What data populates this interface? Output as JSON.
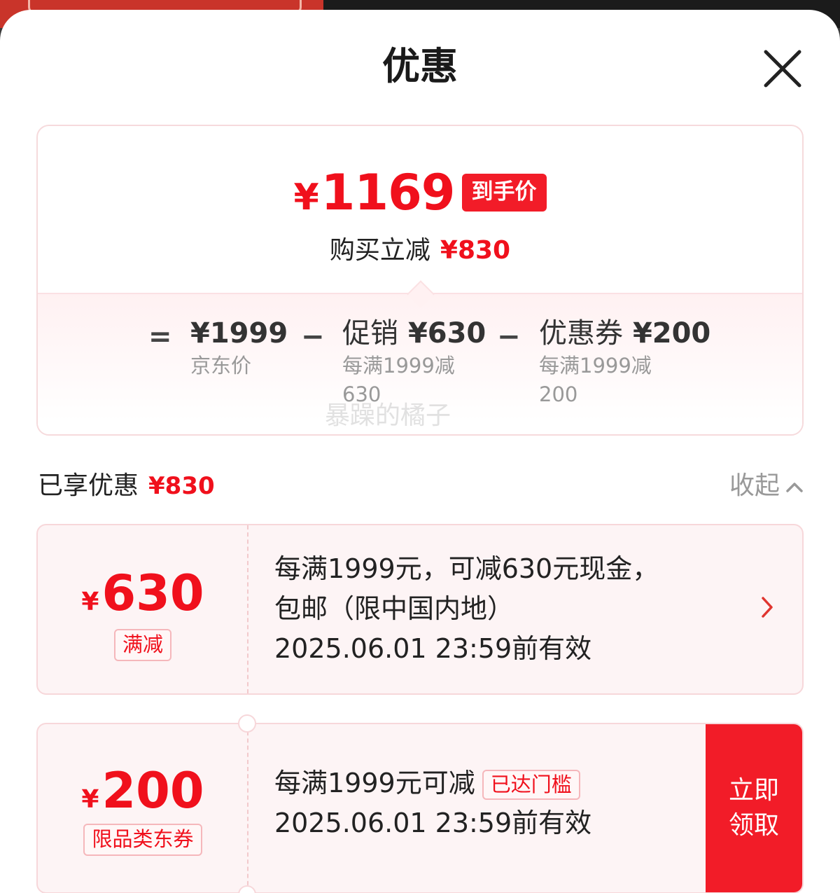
{
  "title": "优惠",
  "summary": {
    "price_yen": "¥",
    "price": "1169",
    "price_tag": "到手价",
    "reduce_label": "购买立减",
    "reduce_amount": "¥830",
    "equals": "=",
    "minus": "−",
    "items": [
      {
        "label": "",
        "value": "¥1999",
        "sub": "京东价"
      },
      {
        "label": "促销",
        "value": "¥630",
        "sub": "每满1999减630"
      },
      {
        "label": "优惠券",
        "value": "¥200",
        "sub": "每满1999减200"
      }
    ],
    "watermark": "暴躁的橘子"
  },
  "enjoyed": {
    "label": "已享优惠",
    "amount": "¥830",
    "collapse_label": "收起"
  },
  "coupons": [
    {
      "yen": "¥",
      "amount": "630",
      "tag": "满减",
      "line1": "每满1999元，可减630元现金，",
      "line2": "包邮（限中国内地）",
      "validity": "2025.06.01 23:59前有效"
    },
    {
      "yen": "¥",
      "amount": "200",
      "tag": "限品类东券",
      "line1": "每满1999元可减",
      "reach_tag": "已达门槛",
      "validity": "2025.06.01 23:59前有效",
      "claim_line1": "立即",
      "claim_line2": "领取"
    }
  ],
  "colors": {
    "accent_red": "#f0101c",
    "tag_border": "#f5b7bb",
    "coupon_bg": "#fdf4f5"
  }
}
